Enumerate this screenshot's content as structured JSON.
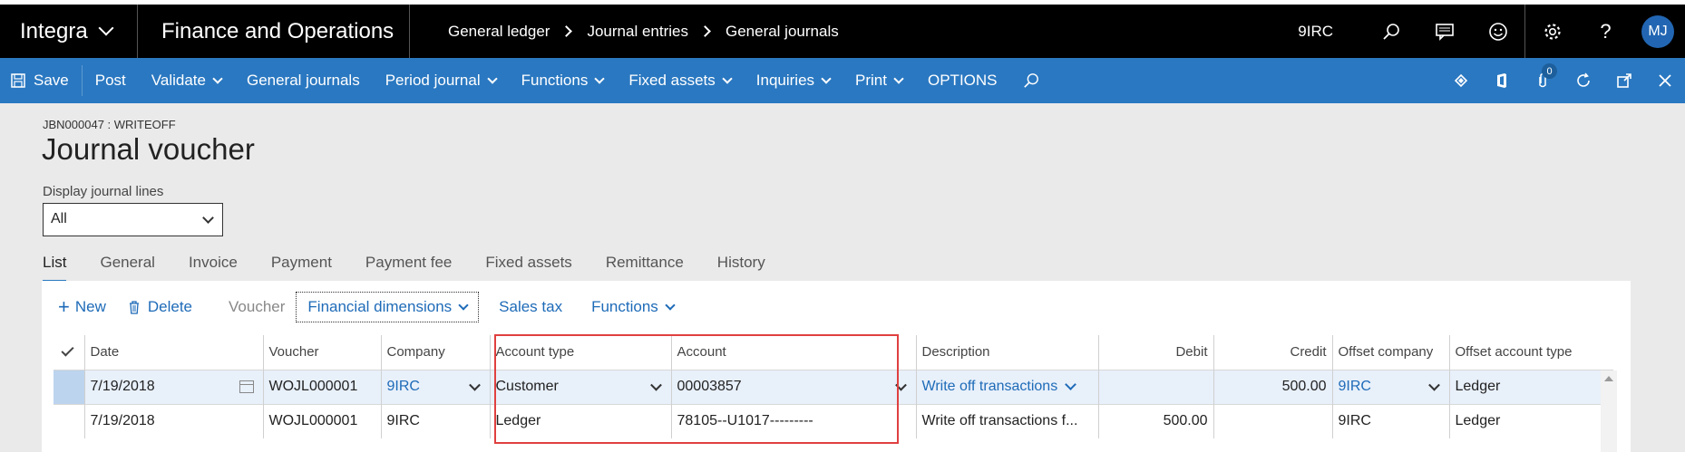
{
  "topbar": {
    "brand": "Integra",
    "app_name": "Finance and Operations",
    "breadcrumbs": [
      "General ledger",
      "Journal entries",
      "General journals"
    ],
    "company": "9IRC",
    "avatar": "MJ",
    "icons": [
      "search-icon",
      "chat-icon",
      "smiley-icon",
      "settings-icon",
      "help-icon"
    ]
  },
  "actionbar": {
    "save": "Save",
    "post": "Post",
    "validate": "Validate",
    "general_journals": "General journals",
    "period_journal": "Period journal",
    "functions": "Functions",
    "fixed_assets": "Fixed assets",
    "inquiries": "Inquiries",
    "print": "Print",
    "options": "OPTIONS",
    "attachments_count": "0",
    "right_icons": [
      "diamond-icon",
      "office-icon",
      "attachment-icon",
      "refresh-icon",
      "open-new-window-icon",
      "close-icon"
    ]
  },
  "page": {
    "subtitle": "JBN000047 : WRITEOFF",
    "title": "Journal voucher",
    "display_label": "Display journal lines",
    "display_value": "All"
  },
  "tabs": [
    "List",
    "General",
    "Invoice",
    "Payment",
    "Payment fee",
    "Fixed assets",
    "Remittance",
    "History"
  ],
  "grid_toolbar": {
    "new": "New",
    "delete": "Delete",
    "voucher": "Voucher",
    "financial_dimensions": "Financial dimensions",
    "sales_tax": "Sales tax",
    "functions": "Functions"
  },
  "columns": {
    "date": "Date",
    "voucher": "Voucher",
    "company": "Company",
    "account_type": "Account type",
    "account": "Account",
    "description": "Description",
    "debit": "Debit",
    "credit": "Credit",
    "offset_company": "Offset company",
    "offset_account_type": "Offset account type"
  },
  "rows": [
    {
      "date": "7/19/2018",
      "voucher": "WOJL000001",
      "company": "9IRC",
      "account_type": "Customer",
      "account": "00003857",
      "description": "Write off transactions",
      "debit": "",
      "credit": "500.00",
      "offset_company": "9IRC",
      "offset_account_type": "Ledger"
    },
    {
      "date": "7/19/2018",
      "voucher": "WOJL000001",
      "company": "9IRC",
      "account_type": "Ledger",
      "account": "78105--U1017---------",
      "description": "Write off transactions f...",
      "debit": "500.00",
      "credit": "",
      "offset_company": "9IRC",
      "offset_account_type": "Ledger"
    }
  ],
  "colors": {
    "topbar": "#000000",
    "actionbar": "#2a78c1",
    "link": "#1e6bb8",
    "highlight_box": "#e04040"
  }
}
